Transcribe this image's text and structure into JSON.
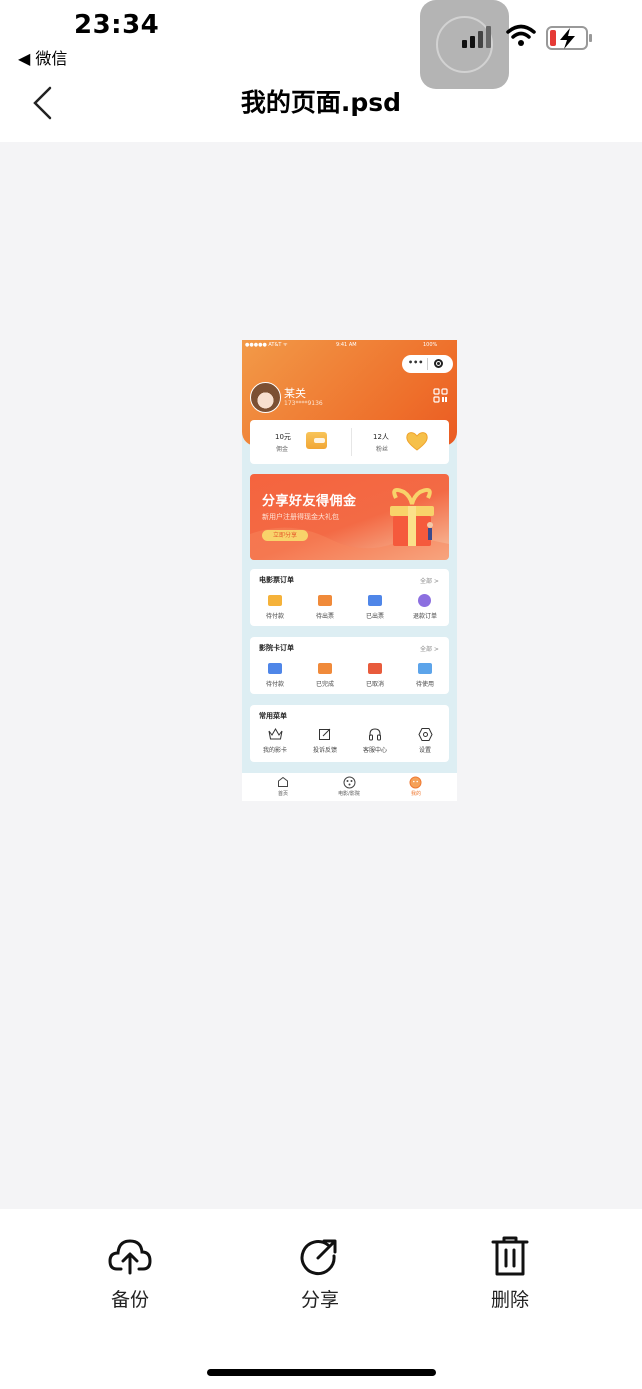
{
  "status_bar": {
    "time": "23:34",
    "back_app": "◀ 微信"
  },
  "nav": {
    "title": "我的页面.psd"
  },
  "preview": {
    "status": {
      "carrier": "●●●●● AT&T ᯤ",
      "time": "9:41 AM",
      "battery": "100%"
    },
    "user": {
      "name": "某关",
      "phone": "173****9136"
    },
    "stats": [
      {
        "num": "10元",
        "label": "佣金"
      },
      {
        "num": "12人",
        "label": "粉丝"
      }
    ],
    "banner": {
      "title": "分享好友得佣金",
      "subtitle": "新用户注册得现金大礼包",
      "button": "立即分享"
    },
    "cards": [
      {
        "title": "电影票订单",
        "all": "全部 >",
        "items": [
          "待付款",
          "待出票",
          "已出票",
          "退款订单"
        ]
      },
      {
        "title": "影院卡订单",
        "all": "全部 >",
        "items": [
          "待付款",
          "已完成",
          "已取消",
          "待使用"
        ]
      },
      {
        "title": "常用菜单",
        "all": "",
        "items": [
          "我的影卡",
          "投诉反馈",
          "客服中心",
          "设置"
        ]
      }
    ],
    "tabs": [
      "首页",
      "电影/影院",
      "我的"
    ]
  },
  "toolbar": {
    "backup": "备份",
    "share": "分享",
    "delete": "删除"
  },
  "colors": {
    "accent": "#ef7a33",
    "preview_bg": "#f4f4f6",
    "card_bg": "#ddeef3"
  },
  "icons": [
    "signal-icon",
    "wifi-icon",
    "battery-charging-icon",
    "back-chevron-icon",
    "cloud-upload-icon",
    "share-arrow-icon",
    "trash-icon"
  ]
}
